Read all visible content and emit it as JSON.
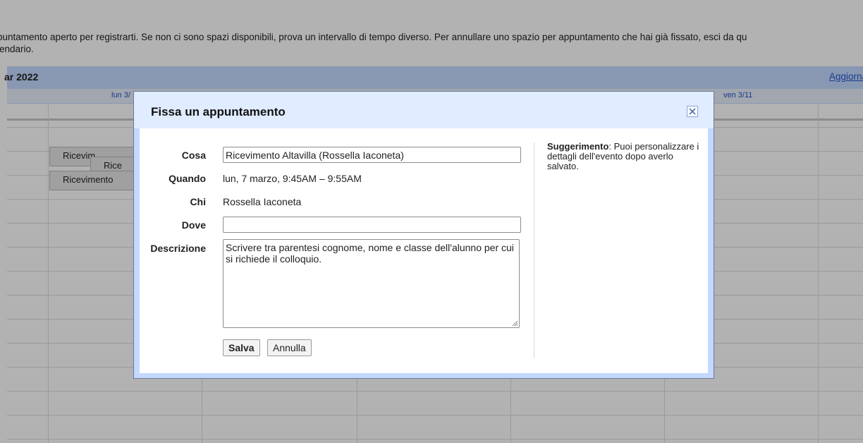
{
  "notice": {
    "line1": "puntamento aperto per registrarti. Se non ci sono spazi disponibili, prova un intervallo di tempo diverso. Per annullare uno spazio per appuntamento che hai già fissato, esci da qu",
    "line2": "lendario."
  },
  "calendar": {
    "title": "ar 2022",
    "refresh_link": "Aggiorna",
    "days": [
      "lun 3/",
      "ven 3/11"
    ],
    "events": [
      "Ricevim",
      "Rice",
      "Ricevimento"
    ]
  },
  "dialog": {
    "title": "Fissa un appuntamento",
    "labels": {
      "what": "Cosa",
      "when": "Quando",
      "who": "Chi",
      "where": "Dove",
      "description": "Descrizione"
    },
    "what_value": "Ricevimento Altavilla (Rossella Iaconeta)",
    "when_value": "lun, 7 marzo, 9:45AM – 9:55AM",
    "who_value": "Rossella Iaconeta",
    "where_value": "",
    "description_value": "Scrivere tra parentesi cognome, nome e classe dell'alunno per cui si richiede il colloquio.",
    "save_label": "Salva",
    "cancel_label": "Annulla",
    "tip_title": "Suggerimento",
    "tip_text": ": Puoi personalizzare i dettagli dell'evento dopo averlo salvato."
  },
  "colors": {
    "accent": "#c3d9ff",
    "dialog_header": "#e0ecff",
    "link": "#2255cc"
  },
  "icons": [
    "close-icon",
    "resize-grip-icon"
  ]
}
